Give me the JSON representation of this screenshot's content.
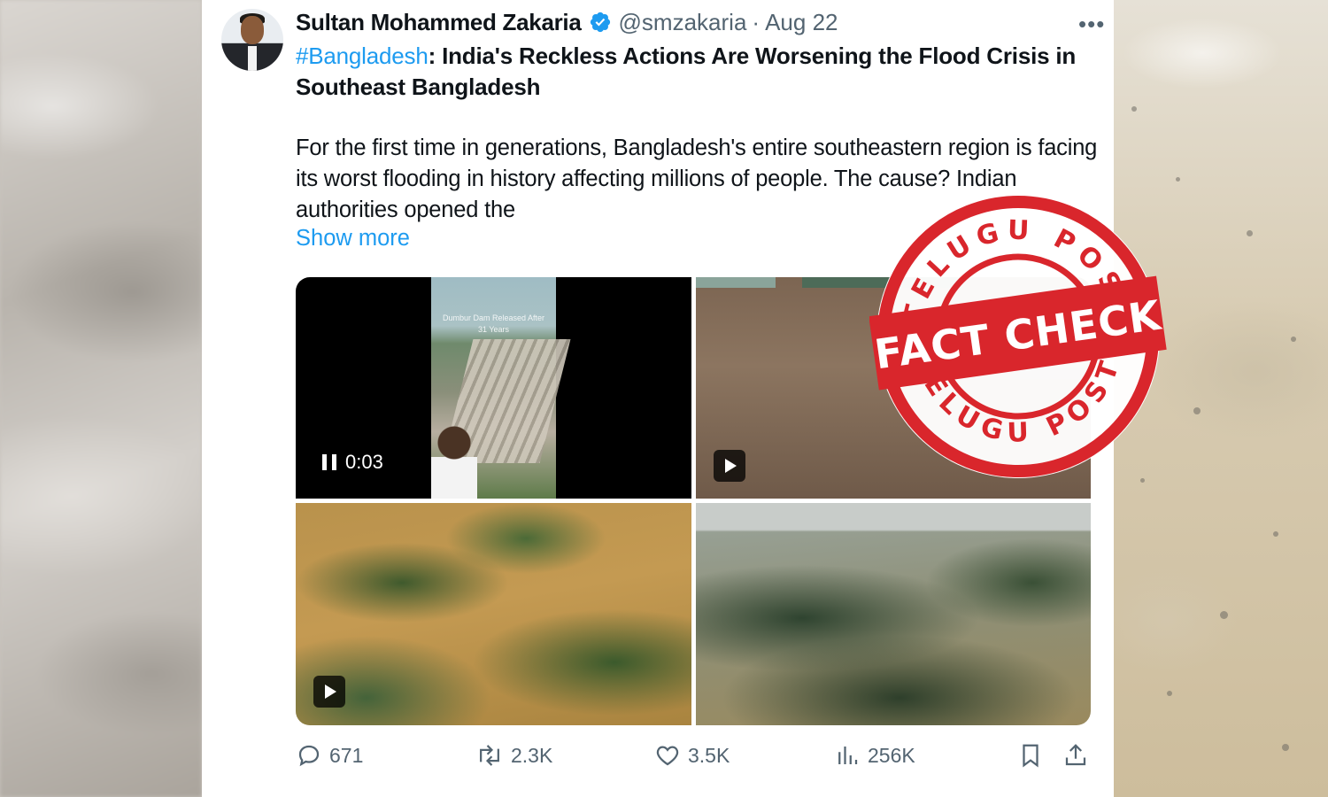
{
  "tweet": {
    "author_name": "Sultan Mohammed Zakaria",
    "handle": "@smzakaria",
    "separator": "·",
    "date": "Aug 22",
    "more_label": "•••",
    "hashtag": "#Bangladesh",
    "title_rest": ": India's Reckless Actions Are Worsening the Flood Crisis in Southeast Bangladesh",
    "body": "For the first time in generations, Bangladesh's entire southeastern region is facing its worst flooding in history affecting millions of people. The cause? Indian authorities opened the",
    "show_more": "Show more"
  },
  "media": {
    "video_time": "0:03",
    "dam_caption": "Dumbur Dam Released After 31 Years"
  },
  "actions": {
    "replies": "671",
    "reposts": "2.3K",
    "likes": "3.5K",
    "views": "256K"
  },
  "stamp": {
    "top_text": "TELUGU POST",
    "center_text": "FACT CHECK",
    "bottom_text": "TELUGU POST",
    "color": "#d9262c"
  },
  "colors": {
    "link": "#1d9bf0",
    "text": "#0f1419",
    "secondary": "#536471"
  }
}
